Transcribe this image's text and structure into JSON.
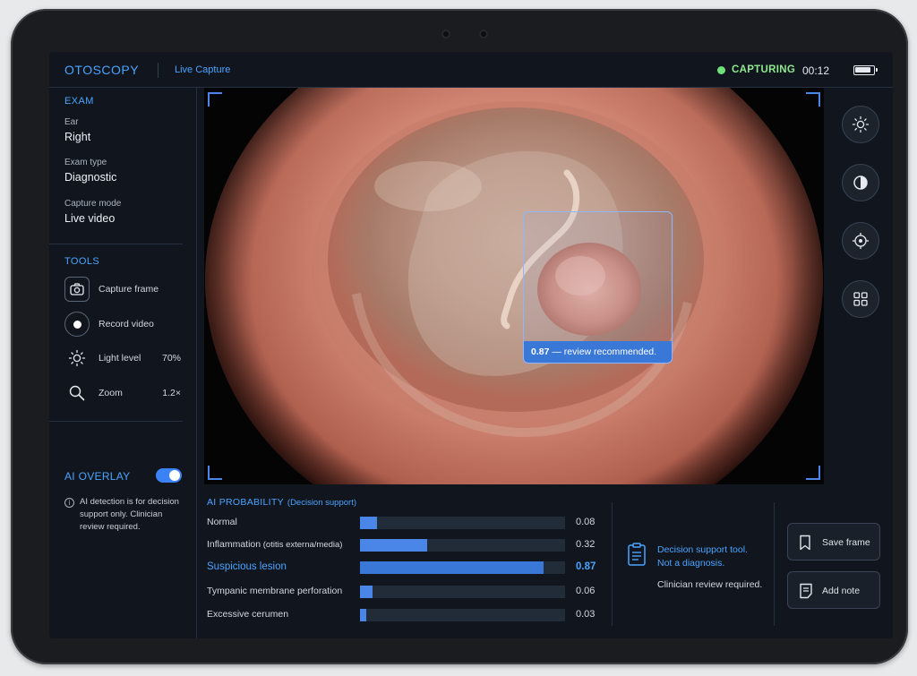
{
  "header": {
    "brand": "OTOSCOPY",
    "mode": "Live Capture",
    "status": "CAPTURING",
    "timer": "00:12"
  },
  "sidebar": {
    "exam_title": "EXAM",
    "fields": [
      {
        "label": "Ear",
        "value": "Right"
      },
      {
        "label": "Exam type",
        "value": "Diagnostic"
      },
      {
        "label": "Capture mode",
        "value": "Live video"
      }
    ],
    "tools_title": "TOOLS",
    "tools": [
      {
        "label": "Capture frame",
        "value": "",
        "icon": "camera-icon"
      },
      {
        "label": "Record video",
        "value": "",
        "icon": "record-icon"
      },
      {
        "label": "Light level",
        "value": "70%",
        "icon": "brightness-icon"
      },
      {
        "label": "Zoom",
        "value": "1.2×",
        "icon": "search-icon"
      }
    ],
    "ai_overlay": {
      "title": "AI OVERLAY",
      "enabled": true,
      "note": "AI detection is for decision support only. Clinician review required."
    }
  },
  "viewer": {
    "detection": {
      "score": "0.87",
      "label": " — review recommended."
    }
  },
  "right_rail": [
    "brightness-icon",
    "contrast-icon",
    "target-icon",
    "grid-icon"
  ],
  "probability": {
    "title": "AI PROBABILITY",
    "subtitle": "(Decision support)",
    "rows": [
      {
        "label": "Normal",
        "label_extra": "",
        "value": 0.08,
        "display": "0.08",
        "highlight": false
      },
      {
        "label": "Inflammation",
        "label_extra": " (otitis externa/media)",
        "value": 0.32,
        "display": "0.32",
        "highlight": false
      },
      {
        "label": "Suspicious lesion",
        "label_extra": "",
        "value": 0.87,
        "display": "0.87",
        "highlight": true
      },
      {
        "label": "Tympanic membrane perforation",
        "label_extra": "",
        "value": 0.06,
        "display": "0.06",
        "highlight": false
      },
      {
        "label": "Excessive cerumen",
        "label_extra": "",
        "value": 0.03,
        "display": "0.03",
        "highlight": false
      }
    ]
  },
  "disclaimer": {
    "line1": "Decision support tool.",
    "line2": "Not a diagnosis.",
    "line3": "Clinician review required."
  },
  "actions": {
    "save_frame": "Save frame",
    "add_note": "Add note"
  },
  "colors": {
    "accent": "#4aa3ff",
    "bar": "#4a86e8",
    "status": "#6fe07a"
  }
}
